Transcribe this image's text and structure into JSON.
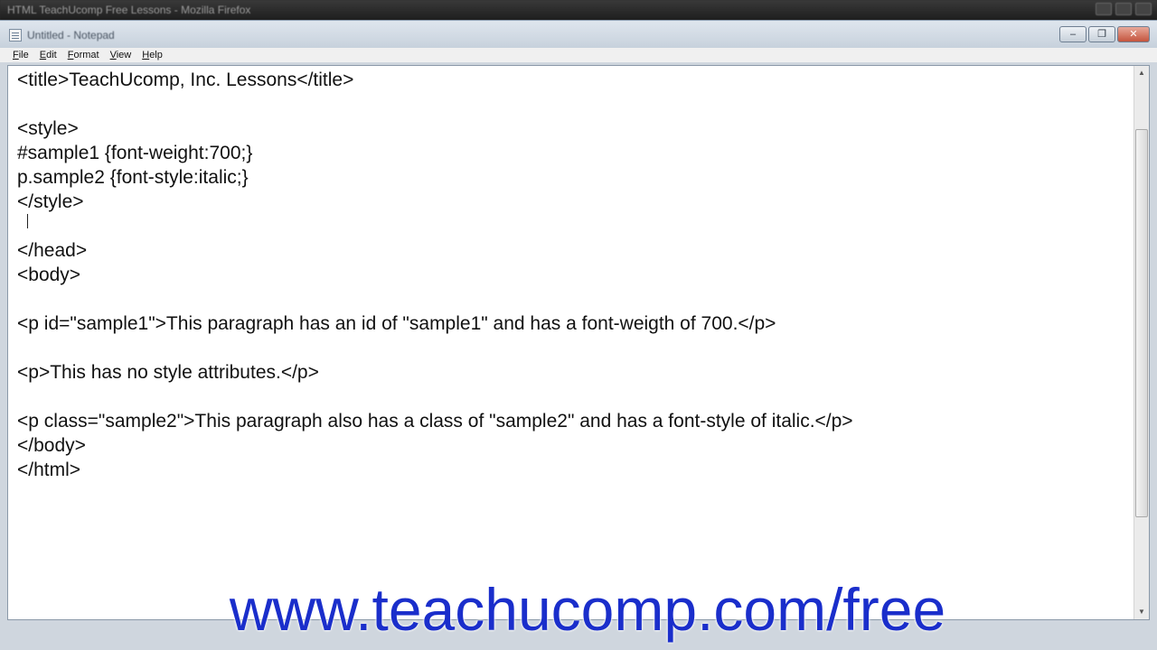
{
  "outer": {
    "title": "HTML TeachUcomp Free Lessons - Mozilla Firefox"
  },
  "window": {
    "title": "Untitled - Notepad",
    "controls": {
      "minimize": "–",
      "maximize": "❐",
      "close": "✕"
    }
  },
  "menu": [
    "File",
    "Edit",
    "Format",
    "View",
    "Help"
  ],
  "editor": {
    "lines": [
      "<title>TeachUcomp, Inc. Lessons</title>",
      "",
      "<style>",
      "#sample1 {font-weight:700;}",
      "p.sample2 {font-style:italic;}",
      "</style>",
      "",
      "</head>",
      "<body>",
      "",
      "<p id=\"sample1\">This paragraph has an id of \"sample1\" and has a font-weigth of 700.</p>",
      "",
      "<p>This has no style attributes.</p>",
      "",
      "<p class=\"sample2\">This paragraph also has a class of \"sample2\" and has a font-style of italic.</p>",
      "</body>",
      "</html>"
    ]
  },
  "watermark": {
    "text": "www.teachucomp.com/free"
  },
  "colors": {
    "watermark": "#1a2ecb",
    "window_frame": "#cfd6de"
  }
}
